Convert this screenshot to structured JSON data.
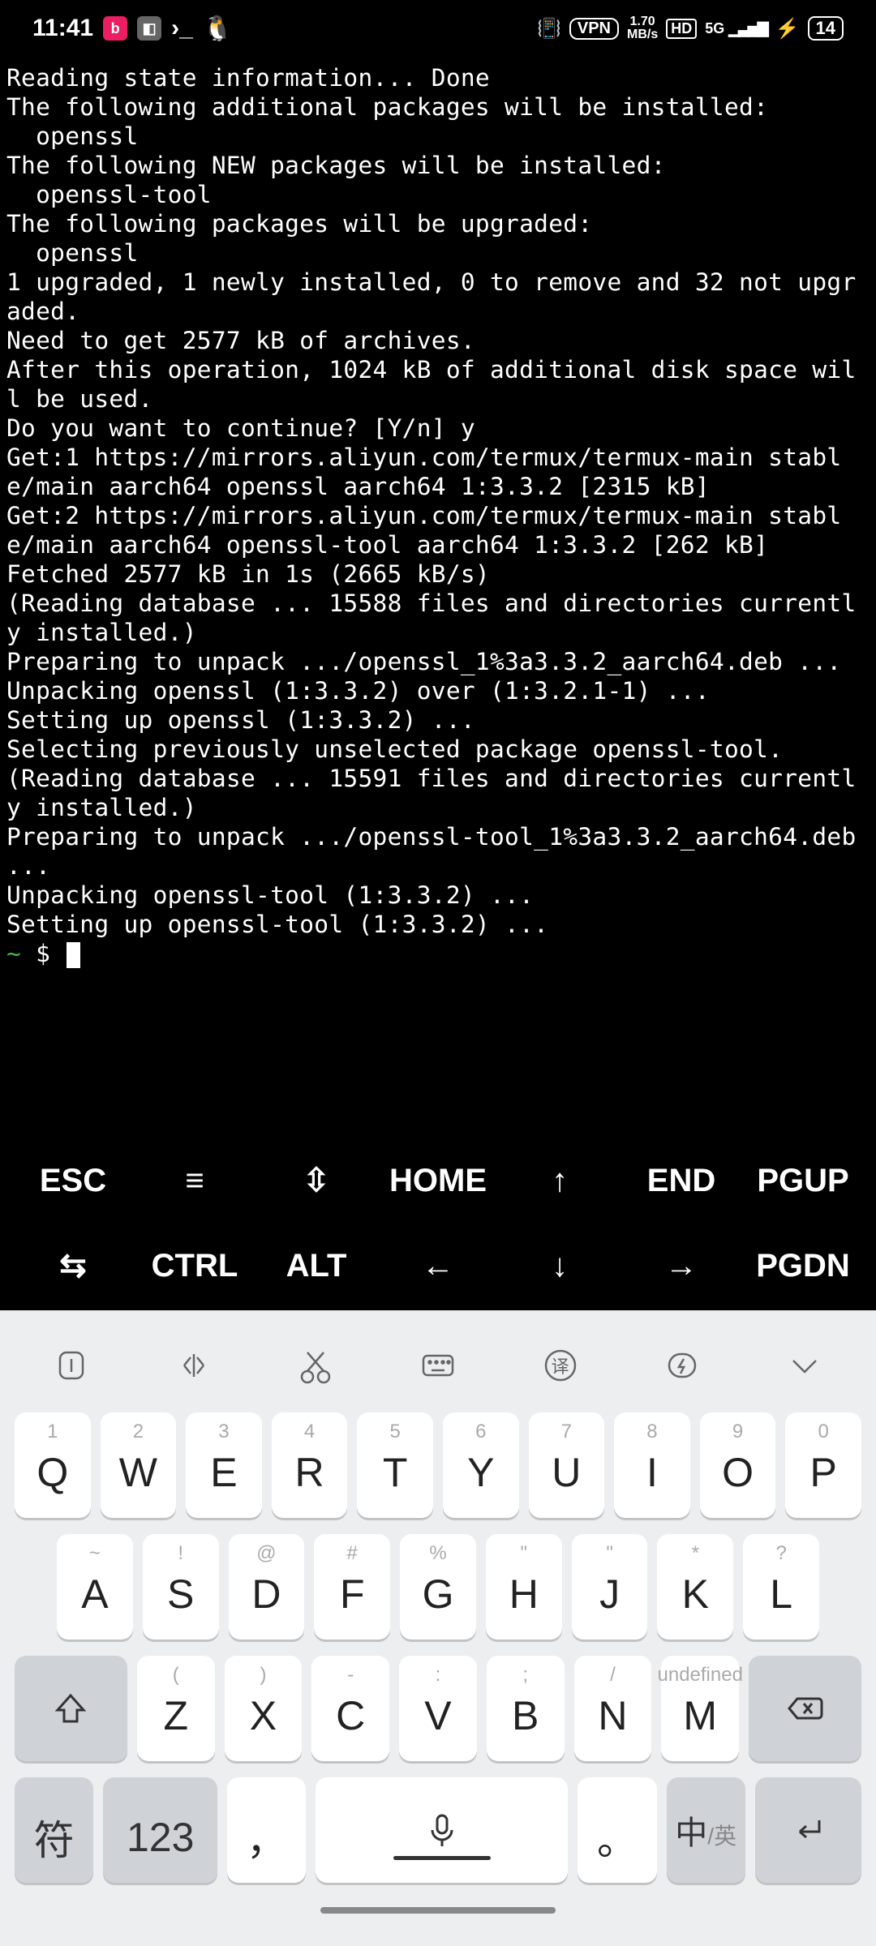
{
  "status_bar": {
    "time": "11:41",
    "icons": {
      "term_glyph": "›_",
      "penguin": "🐧"
    },
    "vpn": "VPN",
    "net_speed_top": "1.70",
    "net_speed_bot": "MB/s",
    "hd": "HD",
    "net_type": "5G",
    "bolt": "⚡",
    "battery": "14"
  },
  "terminal": {
    "lines": [
      "Reading state information... Done",
      "The following additional packages will be installed:",
      "  openssl",
      "The following NEW packages will be installed:",
      "  openssl-tool",
      "The following packages will be upgraded:",
      "  openssl",
      "1 upgraded, 1 newly installed, 0 to remove and 32 not upgraded.",
      "Need to get 2577 kB of archives.",
      "After this operation, 1024 kB of additional disk space will be used.",
      "Do you want to continue? [Y/n] y",
      "Get:1 https://mirrors.aliyun.com/termux/termux-main stable/main aarch64 openssl aarch64 1:3.3.2 [2315 kB]",
      "Get:2 https://mirrors.aliyun.com/termux/termux-main stable/main aarch64 openssl-tool aarch64 1:3.3.2 [262 kB]",
      "Fetched 2577 kB in 1s (2665 kB/s)",
      "(Reading database ... 15588 files and directories currently installed.)",
      "Preparing to unpack .../openssl_1%3a3.3.2_aarch64.deb ...",
      "Unpacking openssl (1:3.3.2) over (1:3.2.1-1) ...",
      "Setting up openssl (1:3.3.2) ...",
      "Selecting previously unselected package openssl-tool.",
      "(Reading database ... 15591 files and directories currently installed.)",
      "Preparing to unpack .../openssl-tool_1%3a3.3.2_aarch64.deb ...",
      "Unpacking openssl-tool (1:3.3.2) ...",
      "Setting up openssl-tool (1:3.3.2) ..."
    ],
    "prompt_dir": "~",
    "prompt_sym": "$"
  },
  "extra_keys": {
    "row1": [
      "ESC",
      "≡",
      "⇳",
      "HOME",
      "↑",
      "END",
      "PGUP"
    ],
    "row2": [
      "⇆",
      "CTRL",
      "ALT",
      "←",
      "↓",
      "→",
      "PGDN"
    ]
  },
  "ime": {
    "tools": [
      "cursor",
      "select",
      "scissors",
      "keyboard",
      "translate",
      "lightning",
      "collapse"
    ],
    "tools_glyph": {
      "translate": "译"
    },
    "row1_sec": [
      "1",
      "2",
      "3",
      "4",
      "5",
      "6",
      "7",
      "8",
      "9",
      "0"
    ],
    "row1_main": [
      "Q",
      "W",
      "E",
      "R",
      "T",
      "Y",
      "U",
      "I",
      "O",
      "P"
    ],
    "row2_sec": [
      "~",
      "!",
      "@",
      "#",
      "%",
      "\"",
      "\"",
      "*",
      "?"
    ],
    "row2_main": [
      "A",
      "S",
      "D",
      "F",
      "G",
      "H",
      "J",
      "K",
      "L"
    ],
    "row3_sec": [
      "(",
      ")",
      "-",
      ":",
      ";",
      "/"
    ],
    "row3_main": [
      "Z",
      "X",
      "C",
      "V",
      "B",
      "N",
      "M"
    ],
    "row4": {
      "sym": "符",
      "num": "123",
      "comma": "，",
      "period": "。",
      "lang_main": "中",
      "lang_sub": "英"
    }
  }
}
